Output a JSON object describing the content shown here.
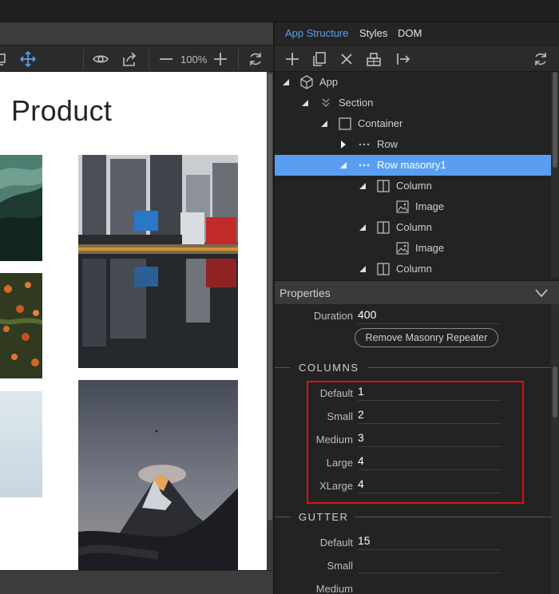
{
  "canvas": {
    "title": "Product",
    "zoom_level": "100%"
  },
  "panel": {
    "tabs": [
      {
        "label": "App Structure",
        "active": true
      },
      {
        "label": "Styles",
        "active": false
      },
      {
        "label": "DOM",
        "active": false
      }
    ],
    "tree": [
      {
        "label": "App",
        "icon": "cube-icon",
        "expanded": true,
        "selected": false
      },
      {
        "label": "Section",
        "icon": "double-chevron-icon",
        "expanded": true,
        "selected": false
      },
      {
        "label": "Container",
        "icon": "square-icon",
        "expanded": true,
        "selected": false
      },
      {
        "label": "Row",
        "icon": "dots-icon",
        "expanded": false,
        "selected": false
      },
      {
        "label": "Row masonry1",
        "icon": "dots-icon",
        "expanded": true,
        "selected": true
      },
      {
        "label": "Column",
        "icon": "column-icon",
        "expanded": true,
        "selected": false
      },
      {
        "label": "Image",
        "icon": "image-icon",
        "expanded": false,
        "selected": false
      },
      {
        "label": "Column",
        "icon": "column-icon",
        "expanded": true,
        "selected": false
      },
      {
        "label": "Image",
        "icon": "image-icon",
        "expanded": false,
        "selected": false
      },
      {
        "label": "Column",
        "icon": "column-icon",
        "expanded": true,
        "selected": false
      }
    ],
    "properties": {
      "title": "Properties",
      "duration_label": "Duration",
      "duration_value": "400",
      "remove_button": "Remove Masonry Repeater",
      "columns_heading": "COLUMNS",
      "columns": [
        {
          "label": "Default",
          "value": "1"
        },
        {
          "label": "Small",
          "value": "2"
        },
        {
          "label": "Medium",
          "value": "3"
        },
        {
          "label": "Large",
          "value": "4"
        },
        {
          "label": "XLarge",
          "value": "4"
        }
      ],
      "gutter_heading": "GUTTER",
      "gutter": [
        {
          "label": "Default",
          "value": "15"
        },
        {
          "label": "Small",
          "value": ""
        },
        {
          "label": "Medium",
          "value": ""
        }
      ]
    }
  },
  "colors": {
    "accent": "#5aa0f0",
    "selection": "#5a9ef2",
    "highlight_box": "#e01010"
  }
}
